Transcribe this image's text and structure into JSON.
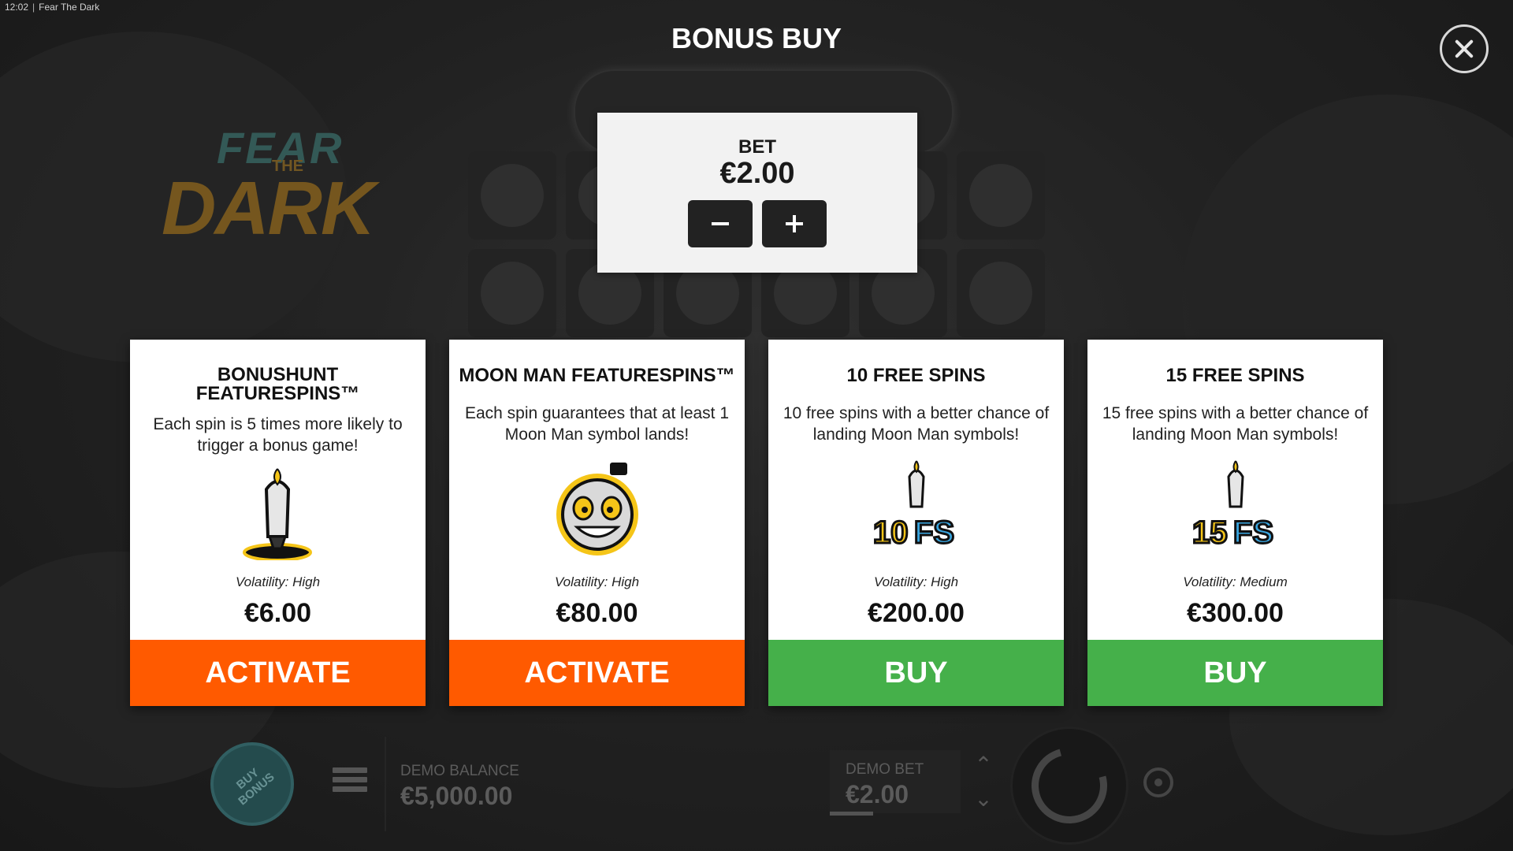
{
  "status": {
    "time": "12:02",
    "app_name": "Fear The Dark"
  },
  "logo": {
    "line1": "FEAR",
    "line2": "THE",
    "line3": "DARK"
  },
  "title": "BONUS BUY",
  "bet": {
    "label": "BET",
    "value": "€2.00"
  },
  "cards": [
    {
      "title": "BONUSHUNT FEATURESPINS™",
      "description": "Each spin is 5 times more likely to trigger a bonus game!",
      "icon": "candle-icon",
      "volatility": "Volatility: High",
      "price": "€6.00",
      "button": "ACTIVATE",
      "button_color": "#ff5a00"
    },
    {
      "title": "MOON MAN FEATURESPINS™",
      "description": "Each spin guarantees that at least 1 Moon Man symbol lands!",
      "icon": "moon-man-icon",
      "volatility": "Volatility: High",
      "price": "€80.00",
      "button": "ACTIVATE",
      "button_color": "#ff5a00"
    },
    {
      "title": "10 FREE SPINS",
      "description": "10 free spins with a better chance of landing Moon Man symbols!",
      "icon": "10-fs-icon",
      "icon_text": "10 FS",
      "volatility": "Volatility: High",
      "price": "€200.00",
      "button": "BUY",
      "button_color": "#45b04a"
    },
    {
      "title": "15 FREE SPINS",
      "description": "15 free spins with a better chance of landing Moon Man symbols!",
      "icon": "15-fs-icon",
      "icon_text": "15 FS",
      "volatility": "Volatility: Medium",
      "price": "€300.00",
      "button": "BUY",
      "button_color": "#45b04a"
    }
  ],
  "bottom": {
    "buy_bonus": "BUY BONUS",
    "demo_balance_label": "DEMO BALANCE",
    "demo_balance_value": "€5,000.00",
    "demo_bet_label": "DEMO BET",
    "demo_bet_value": "€2.00"
  }
}
